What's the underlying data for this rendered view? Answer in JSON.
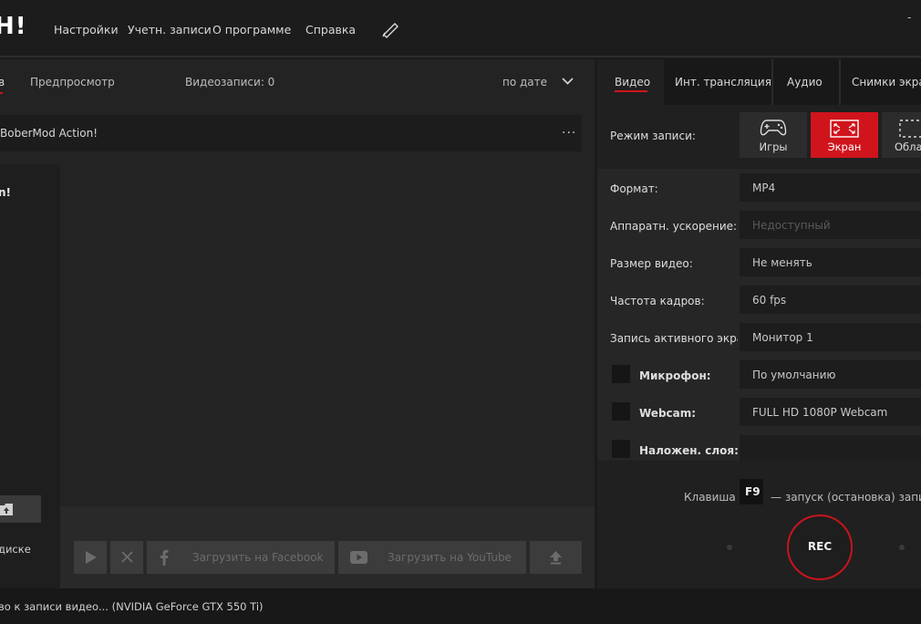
{
  "header": {
    "logo": "Н!",
    "nav": [
      "Настройки",
      "Учетн. записи",
      "О программе",
      "Справка"
    ],
    "window_control": "-"
  },
  "left": {
    "tabs": {
      "active": "в",
      "preview": "Предпросмотр",
      "count": "Видеозаписи: 0",
      "sort": "по дате"
    },
    "game_title": "BoberMod Action!",
    "menu_dots": "...",
    "sidebar_text": "n!",
    "sidebar_caption": "диске",
    "actions": {
      "facebook": "Загрузить на Facebook",
      "youtube": "Загрузить на YouTube"
    }
  },
  "right": {
    "tabs": [
      "Видео",
      "Инт. трансляция",
      "Аудио",
      "Снимки экрана"
    ],
    "mode_label": "Режим записи:",
    "modes": [
      "Игры",
      "Экран",
      "Облас"
    ],
    "settings": [
      {
        "label": "Формат:",
        "value": "MP4"
      },
      {
        "label": "Аппаратн. ускорение:",
        "value": "Недоступный"
      },
      {
        "label": "Размер видео:",
        "value": "Не менять"
      },
      {
        "label": "Частота кадров:",
        "value": "60 fps"
      },
      {
        "label": "Запись активного экрана",
        "value": "Монитор 1"
      },
      {
        "label": "Микрофон:",
        "value": "По умолчанию"
      },
      {
        "label": "Webcam:",
        "value": "FULL HD 1080P Webcam"
      },
      {
        "label": "Наложен. слоя:",
        "value": ""
      }
    ],
    "hotkey": {
      "label": "Клавиша",
      "key": "F9",
      "desc": "— запуск (остановка) записи"
    },
    "rec": "REC"
  },
  "status": "во к записи видео... (NVIDIA GeForce GTX 550 Ti)"
}
